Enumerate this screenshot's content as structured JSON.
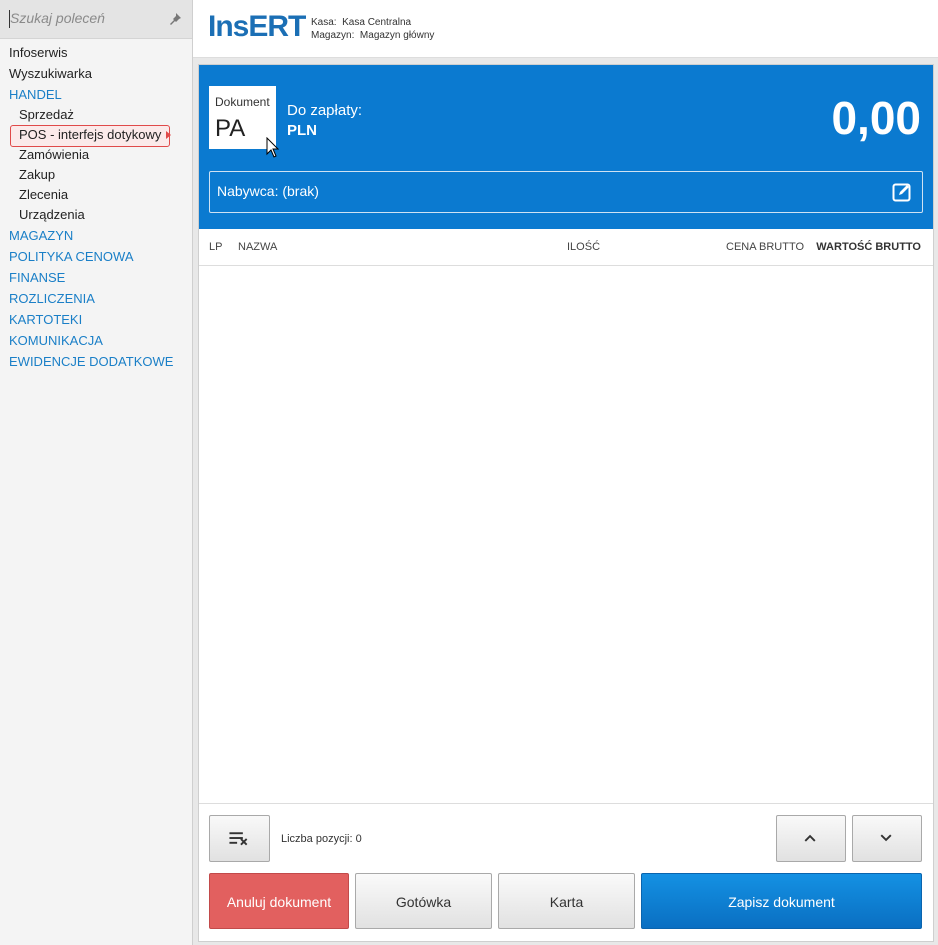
{
  "sidebar": {
    "search_placeholder": "Szukaj poleceń",
    "items": [
      {
        "label": "Infoserwis"
      },
      {
        "label": "Wyszukiwarka"
      },
      {
        "label": "HANDEL"
      },
      {
        "label": "Sprzedaż"
      },
      {
        "label": "POS - interfejs dotykowy"
      },
      {
        "label": "Zamówienia"
      },
      {
        "label": "Zakup"
      },
      {
        "label": "Zlecenia"
      },
      {
        "label": "Urządzenia"
      },
      {
        "label": "MAGAZYN"
      },
      {
        "label": "POLITYKA CENOWA"
      },
      {
        "label": "FINANSE"
      },
      {
        "label": "ROZLICZENIA"
      },
      {
        "label": "KARTOTEKI"
      },
      {
        "label": "KOMUNIKACJA"
      },
      {
        "label": "EWIDENCJE DODATKOWE"
      }
    ]
  },
  "header": {
    "logo": "InsERT",
    "kasa_label": "Kasa:",
    "kasa_value": "Kasa Centralna",
    "magazyn_label": "Magazyn:",
    "magazyn_value": "Magazyn główny"
  },
  "pos": {
    "doc_label": "Dokument",
    "doc_type": "PA",
    "pay_label": "Do zapłaty:",
    "currency": "PLN",
    "amount": "0,00",
    "buyer": "Nabywca: (brak)"
  },
  "table": {
    "columns": [
      "LP",
      "NAZWA",
      "ILOŚĆ",
      "CENA BRUTTO",
      "WARTOŚĆ BRUTTO"
    ]
  },
  "footer": {
    "count_label": "Liczba pozycji: 0",
    "cancel": "Anuluj dokument",
    "cash": "Gotówka",
    "card": "Karta",
    "save": "Zapisz dokument"
  },
  "colors": {
    "accent": "#0b7ad0",
    "section": "#1a7fc7",
    "cancel": "#e2605f"
  }
}
